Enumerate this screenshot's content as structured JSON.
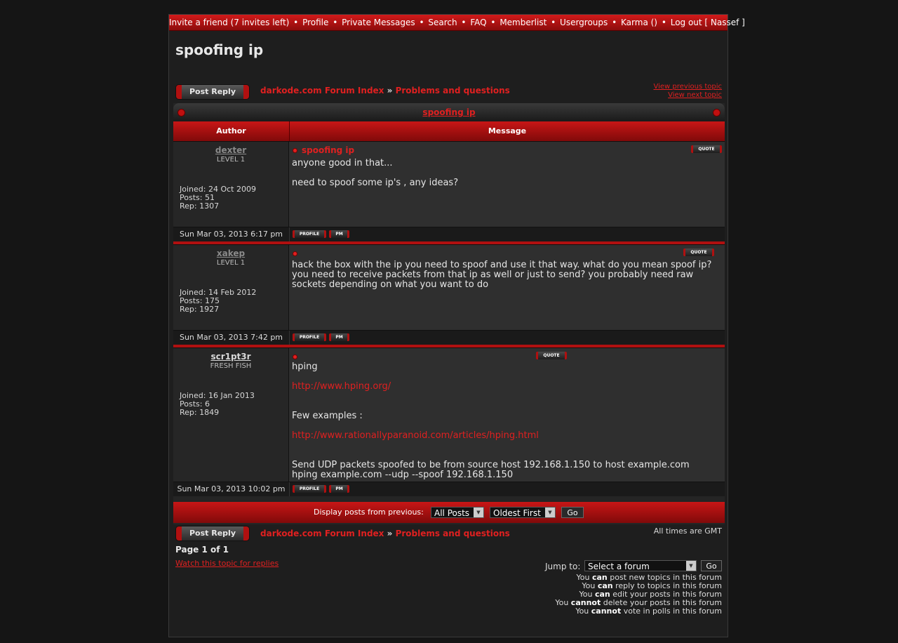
{
  "nav": {
    "items": [
      "Invite a friend (7 invites left)",
      "Profile",
      "Private Messages",
      "Search",
      "FAQ",
      "Memberlist",
      "Usergroups",
      "Karma ()",
      "Log out [ Nassef ]"
    ],
    "separator": "•"
  },
  "page_title": "spoofing ip",
  "post_reply_label": "Post Reply",
  "breadcrumb": {
    "index": "darkode.com Forum Index",
    "sep": "»",
    "forum": "Problems and questions"
  },
  "topic_nav": {
    "previous": "View previous topic",
    "next": "View next topic"
  },
  "topic_title": "spoofing ip",
  "table_headers": {
    "author": "Author",
    "message": "Message"
  },
  "buttons": {
    "quote": "QUOTE",
    "profile": "PROFILE",
    "pm": "PM",
    "go": "Go"
  },
  "posts": [
    {
      "author": "dexter",
      "rank": "LEVEL 1",
      "joined": "Joined: 24 Oct 2009",
      "posts": "Posts: 51",
      "rep": "Rep: 1307",
      "title": "spoofing ip",
      "lines": [
        "anyone good in that...",
        "need to spoof some ip's , any ideas?"
      ],
      "date": "Sun Mar 03, 2013 6:17 pm"
    },
    {
      "author": "xakep",
      "rank": "LEVEL 1",
      "joined": "Joined: 14 Feb 2012",
      "posts": "Posts: 175",
      "rep": "Rep: 1927",
      "title": "",
      "lines": [
        "hack the box with the ip you need to spoof and use it that way. what do you mean spoof ip? you need to receive packets from that ip as well or just to send? you probably need raw sockets depending on what you want to do"
      ],
      "date": "Sun Mar 03, 2013 7:42 pm"
    },
    {
      "author": "scr1pt3r",
      "rank": "FRESH FISH",
      "joined": "Joined: 16 Jan 2013",
      "posts": "Posts: 6",
      "rep": "Rep: 1849",
      "title": "",
      "lines": [
        "hping",
        "http://www.hping.org/",
        "Few examples :",
        "http://www.rationallyparanoid.com/articles/hping.html",
        "Send UDP packets spoofed to be from source host 192.168.1.150 to host example.com",
        "hping example.com --udp --spoof 192.168.1.150"
      ],
      "date": "Sun Mar 03, 2013 10:02 pm"
    }
  ],
  "display_bar": {
    "label": "Display posts from previous:",
    "range_value": "All Posts",
    "order_value": "Oldest First"
  },
  "timezone_note": "All times are GMT",
  "pagination": "Page 1 of 1",
  "watch_link": "Watch this topic for replies",
  "jump": {
    "label": "Jump to:",
    "value": "Select a forum"
  },
  "permissions": [
    {
      "pre": "You ",
      "verb": "can",
      "post": " post new topics in this forum"
    },
    {
      "pre": "You ",
      "verb": "can",
      "post": " reply to topics in this forum"
    },
    {
      "pre": "You ",
      "verb": "can",
      "post": " edit your posts in this forum"
    },
    {
      "pre": "You ",
      "verb": "cannot",
      "post": " delete your posts in this forum"
    },
    {
      "pre": "You ",
      "verb": "cannot",
      "post": " vote in polls in this forum"
    }
  ],
  "colors": {
    "accent": "#e02020",
    "header_red": "#c81616",
    "background": "#151515"
  }
}
